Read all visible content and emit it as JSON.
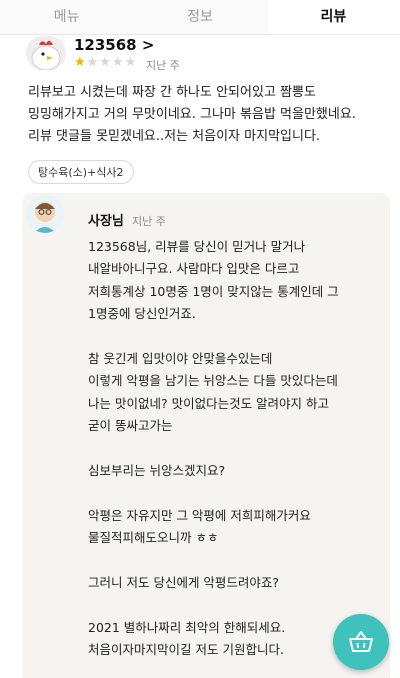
{
  "tabs": [
    {
      "label": "메뉴"
    },
    {
      "label": "정보"
    },
    {
      "label": "리뷰"
    }
  ],
  "review": {
    "username": "123568 >",
    "rating": 1,
    "rating_max": 5,
    "time": "지난 주",
    "text": "리뷰보고 시켰는데 짜장 간 하나도 안되어있고 짬뽕도\n밍밍해가지고 거의 무맛이네요. 그나마 볶음밥 먹을만했네요.\n리뷰 댓글들 못믿겠네요..저는 처음이자 마지막입니다.",
    "menu_tag": "탕수육(소)+식사2"
  },
  "owner_reply": {
    "name": "사장님",
    "time": "지난 주",
    "text": "123568님, 리뷰를 당신이 믿거나 말거나\n내알바아니구요. 사람마다 입맛은 다르고\n저희통계상 10명중 1명이 맞지않는 통계인데 그\n1명중에 당신인거죠.\n\n참 웃긴게 입맛이야 안맞을수있는데\n이렇게 악평을 남기는 뉘앙스는 다들 맛있다는데\n나는 맛이없네? 맛이없다는것도 알려야지 하고\n굳이 똥싸고가는\n\n심보부리는 뉘앙스겠지요?\n\n악평은 자유지만 그 악평에 저희피해가커요\n물질적피해도오니까 ㅎㅎ\n\n그러니 저도 당신에게 악평드려야죠?\n\n2021 별하나짜리 최악의 한해되세요.\n처음이자마지막이길 저도 기원합니다."
  },
  "cart_button": {
    "icon": "shopping-basket-icon",
    "color": "#3fc2bc"
  },
  "colors": {
    "star": "#f2b400",
    "accent": "#3fc2bc"
  }
}
